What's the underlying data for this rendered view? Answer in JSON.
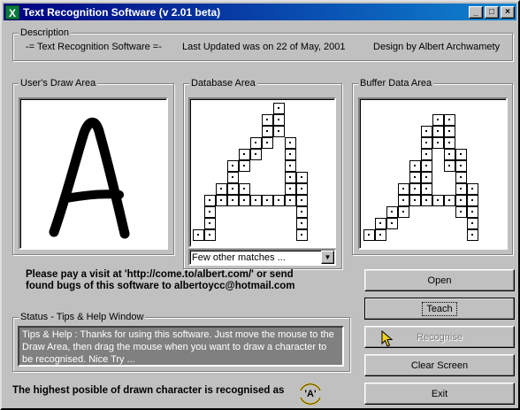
{
  "window": {
    "title": "Text Recognition Software (v 2.01 beta)",
    "icon": "x-app-icon",
    "minimize": "_",
    "maximize": "□",
    "close": "×"
  },
  "description": {
    "label": "Description",
    "name": "-= Text Recognition Software =-",
    "updated": "Last Updated was on 22 of May, 2001",
    "author": "Design by Albert Archwamety"
  },
  "areas": {
    "draw_label": "User's Draw Area",
    "database_label": "Database Area",
    "buffer_label": "Buffer Data Area"
  },
  "database_grid": [
    "0000000100",
    "0000001100",
    "0000001100",
    "0000011010",
    "0000110010",
    "0001100010",
    "0001000011",
    "0011100011",
    "0111111111",
    "0100000001",
    "0100000001",
    "1100000001"
  ],
  "buffer_grid": [
    "0000000000",
    "0000001100",
    "0000011100",
    "0000011100",
    "0000010110",
    "0000110110",
    "0000110010",
    "0001110011",
    "0001111111",
    "0011000011",
    "0110000001",
    "1100000001"
  ],
  "matches_combo": {
    "value": "Few other matches ..."
  },
  "visit_text": "Please pay a visit at 'http://come.to/albert.com/' or send found bugs of this software to albertoycc@hotmail.com",
  "status": {
    "label": "Status - Tips & Help Window",
    "text": "Tips & Help : Thanks for using this software. Just move the mouse to the Draw Area, then drag the mouse when you want to draw a character to be recognised. Nice Try ..."
  },
  "buttons": {
    "open": "Open",
    "teach": "Teach",
    "recognise": "Recognise",
    "clear": "Clear Screen",
    "exit": "Exit"
  },
  "result": {
    "prefix": "The highest posible of drawn character is recognised as",
    "char": "'A'"
  },
  "colors": {
    "title_start": "#000080",
    "title_end": "#1084d0",
    "face": "#c0c0c0",
    "status_bg": "#808080"
  }
}
